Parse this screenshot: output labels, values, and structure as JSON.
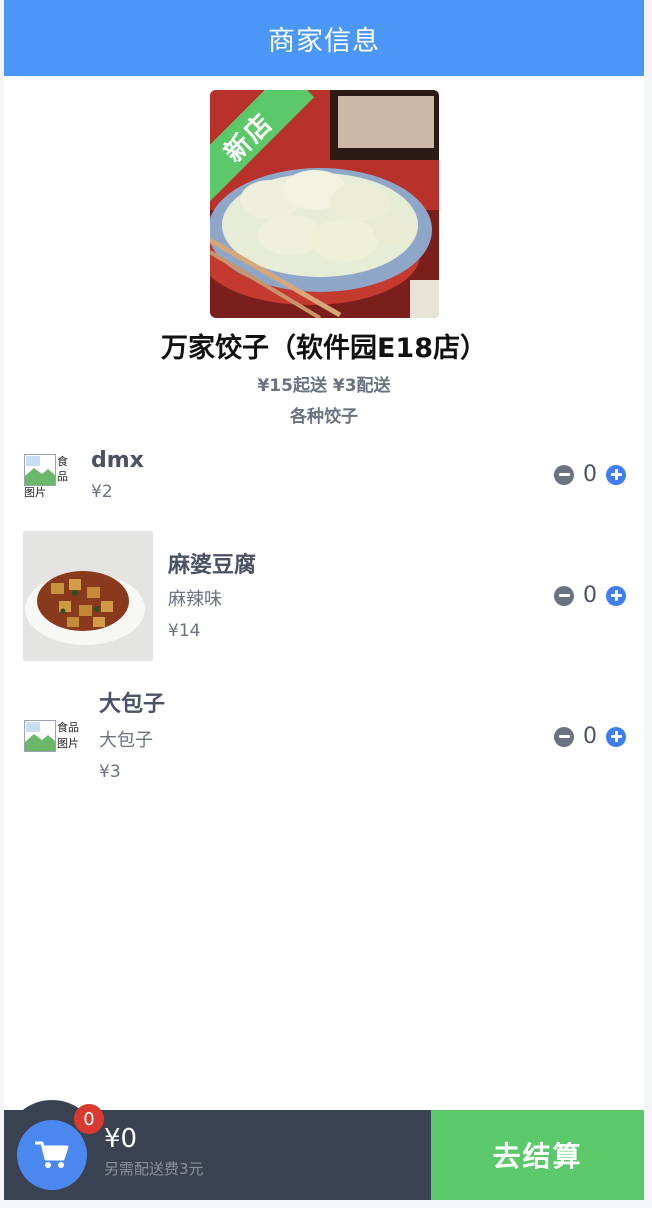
{
  "header": {
    "title": "商家信息"
  },
  "shop": {
    "tag": "新店",
    "name": "万家饺子（软件园E18店）",
    "delivery_info": "¥15起送 ¥3配送",
    "description": "各种饺子"
  },
  "foods": [
    {
      "name": "dmx",
      "description": "",
      "price": "¥2",
      "quantity": "0",
      "image_alt": "食品图片",
      "image_alt_lines": [
        "食",
        "品",
        "图片"
      ]
    },
    {
      "name": "麻婆豆腐",
      "description": "麻辣味",
      "price": "¥14",
      "quantity": "0"
    },
    {
      "name": "大包子",
      "description": "大包子",
      "price": "¥3",
      "quantity": "0",
      "image_alt": "食品图片",
      "image_alt_lines": [
        "食品",
        "图片"
      ]
    }
  ],
  "cart": {
    "count": "0",
    "total": "¥0",
    "delivery_note": "另需配送费3元",
    "checkout_label": "去结算"
  },
  "colors": {
    "header": "#4a97f5",
    "checkout": "#5bc86a",
    "cart_bar": "#3a4150",
    "badge": "#d93a30",
    "plus": "#3f7ef0"
  }
}
